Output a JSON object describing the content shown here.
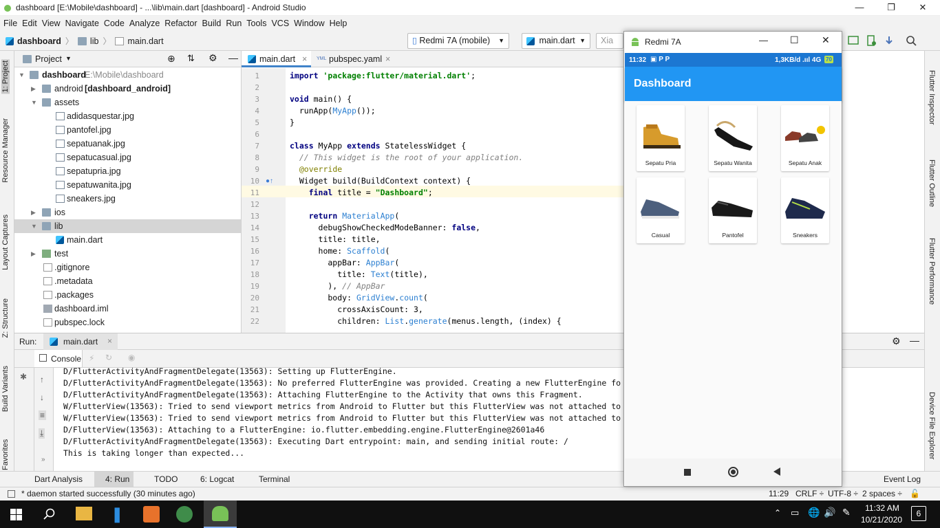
{
  "window": {
    "title": "dashboard [E:\\Mobile\\dashboard] - ...\\lib\\main.dart [dashboard] - Android Studio"
  },
  "menu": [
    "File",
    "Edit",
    "View",
    "Navigate",
    "Code",
    "Analyze",
    "Refactor",
    "Build",
    "Run",
    "Tools",
    "VCS",
    "Window",
    "Help"
  ],
  "breadcrumb": [
    "dashboard",
    "lib",
    "main.dart"
  ],
  "toolbar": {
    "device": "Redmi 7A (mobile)",
    "run_config": "main.dart",
    "partial": "Xia"
  },
  "project": {
    "title": "Project",
    "root": "dashboard",
    "root_path": "E:\\Mobile\\dashboard",
    "items": [
      {
        "label": "android",
        "extra": "[dashboard_android]"
      },
      {
        "label": "assets"
      },
      {
        "label": "adidasquestar.jpg"
      },
      {
        "label": "pantofel.jpg"
      },
      {
        "label": "sepatuanak.jpg"
      },
      {
        "label": "sepatucasual.jpg"
      },
      {
        "label": "sepatupria.jpg"
      },
      {
        "label": "sepatuwanita.jpg"
      },
      {
        "label": "sneakers.jpg"
      },
      {
        "label": "ios"
      },
      {
        "label": "lib"
      },
      {
        "label": "main.dart"
      },
      {
        "label": "test"
      },
      {
        "label": ".gitignore"
      },
      {
        "label": ".metadata"
      },
      {
        "label": ".packages"
      },
      {
        "label": "dashboard.iml"
      },
      {
        "label": "pubspec.lock"
      }
    ]
  },
  "editor": {
    "tabs": [
      "main.dart",
      "pubspec.yaml"
    ],
    "line_numbers": [
      "1",
      "2",
      "3",
      "4",
      "5",
      "6",
      "7",
      "8",
      "9",
      "10",
      "11",
      "12",
      "13",
      "14",
      "15",
      "16",
      "17",
      "18",
      "19",
      "20",
      "21",
      "22"
    ]
  },
  "left_tools": [
    "1: Project",
    "Resource Manager",
    "Layout Captures",
    "Z: Structure",
    "Build Variants",
    "Favorites"
  ],
  "right_tools": [
    "Flutter Inspector",
    "Flutter Outline",
    "Flutter Performance",
    "Device File Explorer"
  ],
  "run": {
    "label": "Run:",
    "config": "main.dart",
    "console_tab": "Console",
    "log": [
      "D/FlutterActivityAndFragmentDelegate(13563): Setting up FlutterEngine.",
      "D/FlutterActivityAndFragmentDelegate(13563): No preferred FlutterEngine was provided. Creating a new FlutterEngine fo",
      "D/FlutterActivityAndFragmentDelegate(13563): Attaching FlutterEngine to the Activity that owns this Fragment.",
      "W/FlutterView(13563): Tried to send viewport metrics from Android to Flutter but this FlutterView was not attached to",
      "W/FlutterView(13563): Tried to send viewport metrics from Android to Flutter but this FlutterView was not attached to",
      "D/FlutterView(13563): Attaching to a FlutterEngine: io.flutter.embedding.engine.FlutterEngine@2601a46",
      "D/FlutterActivityAndFragmentDelegate(13563): Executing Dart entrypoint: main, and sending initial route: /",
      "This is taking longer than expected..."
    ]
  },
  "bottom_tabs": [
    "Dart Analysis",
    "4: Run",
    "TODO",
    "6: Logcat",
    "Terminal",
    "Event Log"
  ],
  "status": {
    "message": "* daemon started successfully (30 minutes ago)",
    "position": "11:29",
    "line_sep": "CRLF ÷",
    "encoding": "UTF-8 ÷",
    "indent": "2 spaces ÷"
  },
  "emulator": {
    "title": "Redmi 7A",
    "status_time": "11:32",
    "status_right": "1,3KB/d .ııl 4G",
    "battery": "70",
    "app_title": "Dashboard",
    "items": [
      "Sepatu Pria",
      "Sepatu Wanita",
      "Sepatu Anak",
      "Casual",
      "Pantofel",
      "Sneakers"
    ]
  },
  "taskbar": {
    "time": "11:32 AM",
    "date": "10/21/2020",
    "notifications": "6"
  },
  "colors": {
    "accent": "#2196f3",
    "statusbar": "#1c77d2",
    "selection": "#d5d5d5"
  }
}
